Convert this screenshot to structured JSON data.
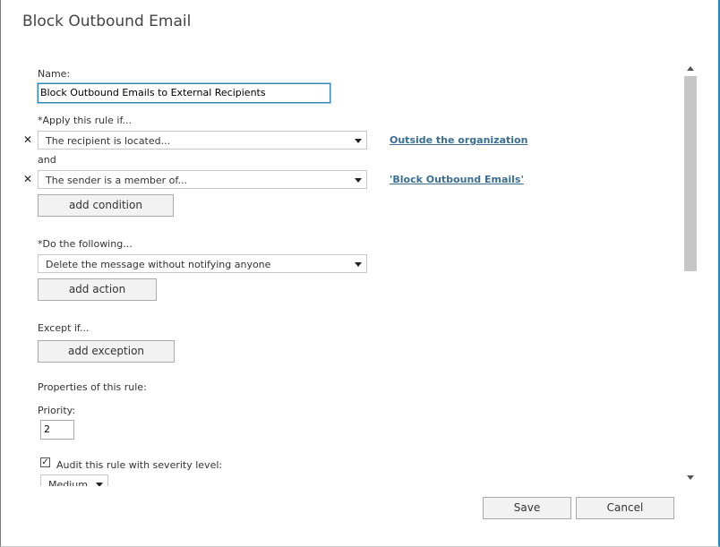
{
  "window": {
    "title": "Block Outbound Email"
  },
  "form": {
    "name_label": "Name:",
    "name_value": "Block Outbound Emails to External Recipients",
    "apply_label": "*Apply this rule if...",
    "condition1": {
      "select_value": "The recipient is located...",
      "link": "Outside the organization"
    },
    "and_label": "and",
    "condition2": {
      "select_value": "The sender is a member of...",
      "link": "'Block Outbound Emails'"
    },
    "add_condition_label": "add condition",
    "do_label": "*Do the following...",
    "action_select_value": "Delete the message without notifying anyone",
    "add_action_label": "add action",
    "except_label": "Except if...",
    "add_exception_label": "add exception",
    "properties_label": "Properties of this rule:",
    "priority_label": "Priority:",
    "priority_value": "2",
    "audit_label": "Audit this rule with severity level:",
    "audit_checked": true,
    "severity_value": "Medium"
  },
  "footer": {
    "save_label": "Save",
    "cancel_label": "Cancel"
  },
  "icons": {
    "remove": "x-icon",
    "dropdown": "chevron-down-icon",
    "checkbox": "checkmark-icon"
  }
}
